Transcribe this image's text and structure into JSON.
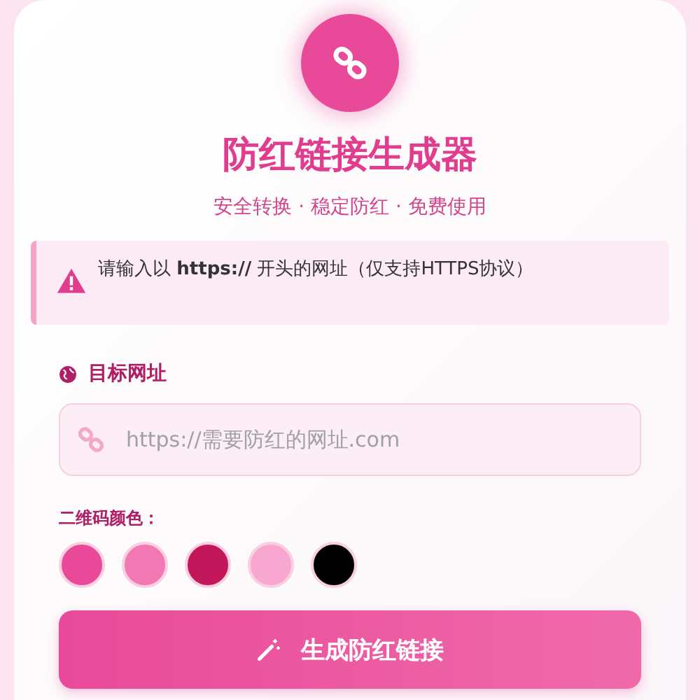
{
  "header": {
    "title": "防红链接生成器",
    "subtitle": "安全转换 · 稳定防红 · 免费使用"
  },
  "notice": {
    "text": "请输入以 **https://** 开头的网址（仅支持HTTPS协议）"
  },
  "url_field": {
    "label": "目标网址",
    "placeholder": "https://需要防红的网址.com"
  },
  "qr_colors": {
    "label": "二维码颜色：",
    "swatches": [
      {
        "color": "#e84a99"
      },
      {
        "color": "#f278b4"
      },
      {
        "color": "#c2185b"
      },
      {
        "color": "#f8a8d0"
      },
      {
        "color": "#000000"
      }
    ]
  },
  "generate_button": {
    "label": "生成防红链接"
  }
}
